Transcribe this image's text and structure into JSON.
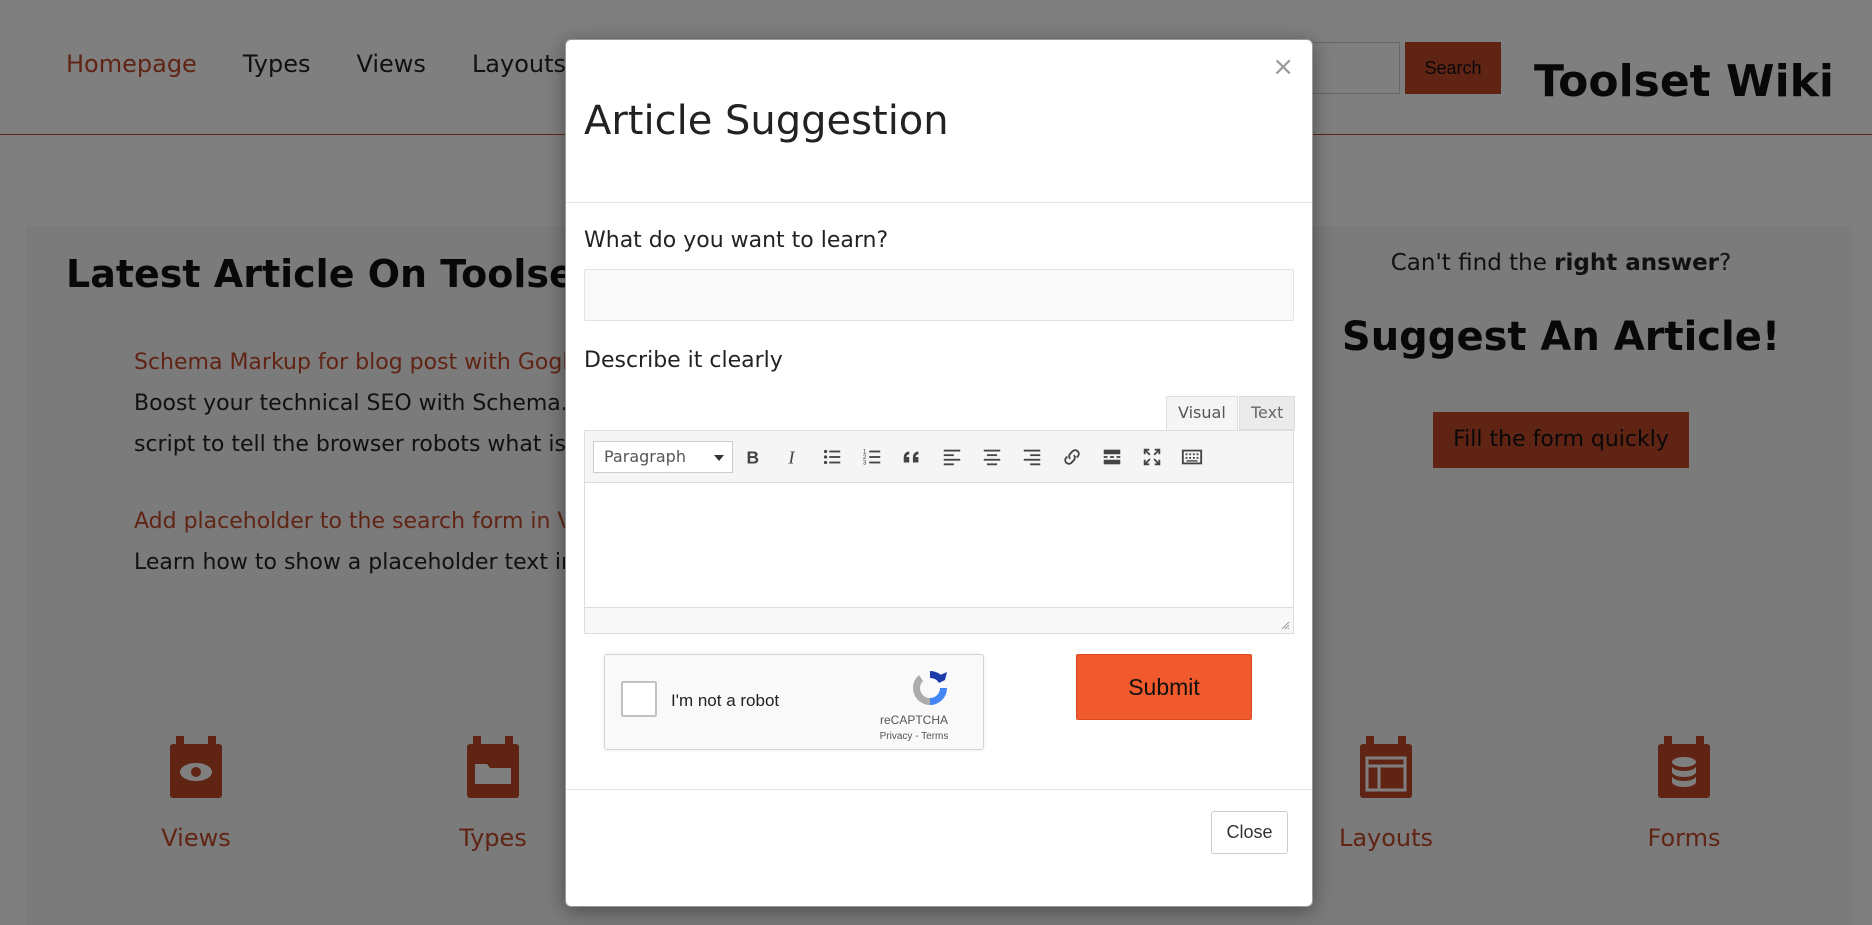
{
  "header": {
    "nav": [
      "Homepage",
      "Types",
      "Views",
      "Layouts"
    ],
    "active_nav": "Homepage",
    "search_label": "Search",
    "brand": "Toolset Wiki"
  },
  "main": {
    "latest_title": "Latest Article On Toolset W",
    "articles": [
      {
        "title": "Schema Markup for blog post with Gogle",
        "desc_lines": [
          "Boost your technical SEO with Schema.or",
          "script to tell the browser robots what is yo"
        ]
      },
      {
        "title": "Add placeholder to the search form in Vie",
        "desc_lines": [
          "Learn how to show a placeholder text in t"
        ]
      }
    ]
  },
  "sidebar": {
    "question_prefix": "Can't find the ",
    "question_bold": "right answer",
    "question_suffix": "?",
    "title": "Suggest An Article!",
    "button": "Fill the form quickly"
  },
  "tiles": [
    {
      "label": "Views",
      "icon": "eye-icon"
    },
    {
      "label": "Types",
      "icon": "folder-icon"
    },
    {
      "label": "Layouts",
      "icon": "layout-icon"
    },
    {
      "label": "Forms",
      "icon": "database-icon"
    }
  ],
  "modal": {
    "title": "Article Suggestion",
    "close_x": "×",
    "learn_label": "What do you want to learn?",
    "learn_value": "",
    "describe_label": "Describe it clearly",
    "tab_visual": "Visual",
    "tab_text": "Text",
    "format_value": "Paragraph",
    "toolbar_icons": [
      "bold-icon",
      "italic-icon",
      "bullet-list-icon",
      "numbered-list-icon",
      "blockquote-icon",
      "align-left-icon",
      "align-center-icon",
      "align-right-icon",
      "link-icon",
      "read-more-icon",
      "fullscreen-icon",
      "toolbar-toggle-icon"
    ],
    "recaptcha_label": "I'm not a robot",
    "recaptcha_brand": "reCAPTCHA",
    "recaptcha_terms": "Privacy - Terms",
    "submit": "Submit",
    "close": "Close"
  },
  "colors": {
    "accent": "#c0482a",
    "submit": "#f05a2c"
  }
}
